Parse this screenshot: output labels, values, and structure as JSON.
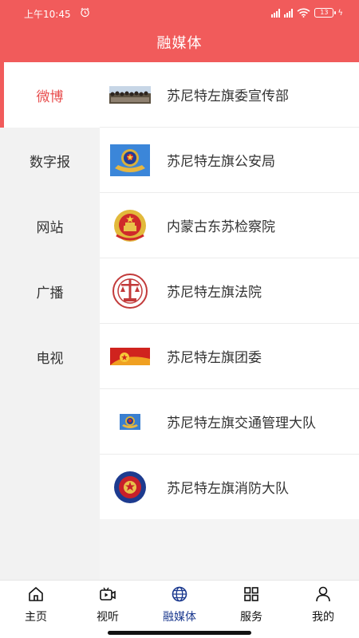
{
  "status_bar": {
    "time": "上午10:45",
    "battery": "13"
  },
  "header": {
    "title": "融媒体"
  },
  "sidebar": {
    "items": [
      {
        "label": "微博",
        "active": true
      },
      {
        "label": "数字报",
        "active": false
      },
      {
        "label": "网站",
        "active": false
      },
      {
        "label": "广播",
        "active": false
      },
      {
        "label": "电视",
        "active": false
      }
    ]
  },
  "accounts": [
    {
      "name": "苏尼特左旗委宣传部",
      "logo": "group-photo-icon"
    },
    {
      "name": "苏尼特左旗公安局",
      "logo": "police-emblem-icon"
    },
    {
      "name": "内蒙古东苏检察院",
      "logo": "national-emblem-icon"
    },
    {
      "name": "苏尼特左旗法院",
      "logo": "court-emblem-icon"
    },
    {
      "name": "苏尼特左旗团委",
      "logo": "youth-league-icon"
    },
    {
      "name": "苏尼特左旗交通管理大队",
      "logo": "traffic-police-icon"
    },
    {
      "name": "苏尼特左旗消防大队",
      "logo": "fire-rescue-icon"
    }
  ],
  "bottom_nav": [
    {
      "label": "主页",
      "icon": "home-icon"
    },
    {
      "label": "视听",
      "icon": "video-icon"
    },
    {
      "label": "融媒体",
      "icon": "globe-icon",
      "active": true
    },
    {
      "label": "服务",
      "icon": "grid-icon"
    },
    {
      "label": "我的",
      "icon": "person-icon"
    }
  ],
  "colors": {
    "accent": "#f15b5b",
    "active_tab": "#1c3a8f"
  }
}
